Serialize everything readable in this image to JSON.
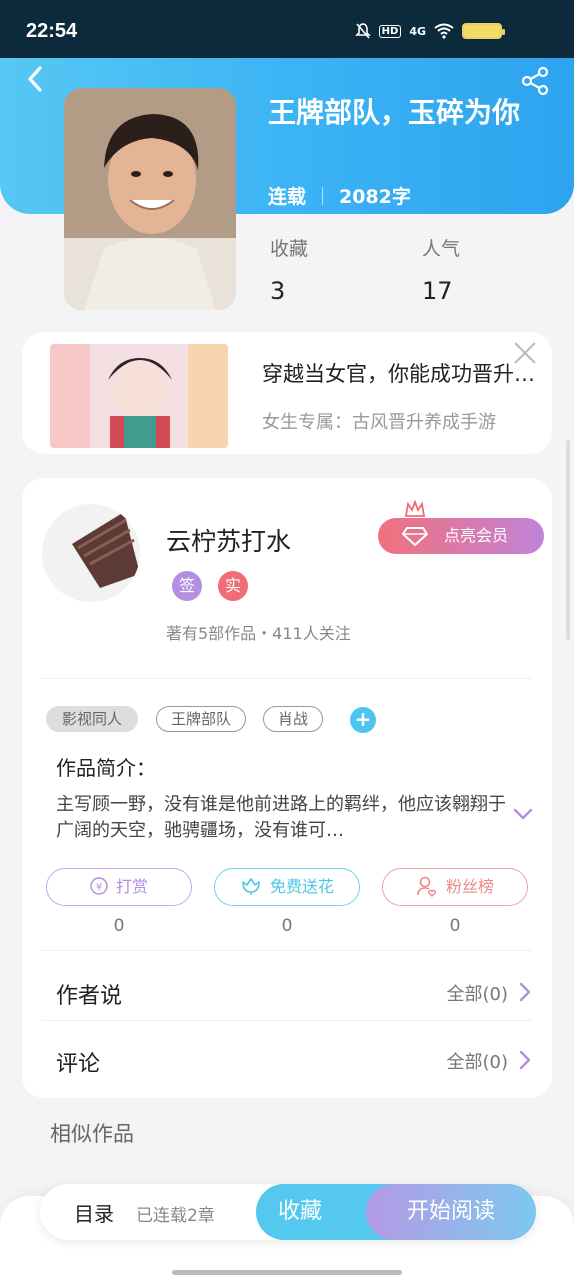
{
  "status_bar": {
    "time": "22:54",
    "network": "4G",
    "hd": "HD"
  },
  "book": {
    "title": "王牌部队，玉碎为你",
    "status": "连载",
    "word_count": "2082字",
    "stats": [
      {
        "label": "收藏",
        "value": "3"
      },
      {
        "label": "人气",
        "value": "17"
      }
    ]
  },
  "ad": {
    "title": "穿越当女官，你能成功晋升吗？",
    "subtitle": "女生专属：古风晋升养成手游"
  },
  "author": {
    "name": "云柠苏打水",
    "badges": [
      "签",
      "实"
    ],
    "stats": "著有5部作品・411人关注",
    "vip_label": "点亮会员"
  },
  "tags": [
    "影视同人",
    "王牌部队",
    "肖战"
  ],
  "intro": {
    "title": "作品简介：",
    "text": "主写顾一野，没有谁是他前进路上的羁绊，他应该翱翔于广阔的天空，驰骋疆场，没有谁可…"
  },
  "actions": [
    {
      "label": "打赏",
      "count": "0"
    },
    {
      "label": "免费送花",
      "count": "0"
    },
    {
      "label": "粉丝榜",
      "count": "0"
    }
  ],
  "rows": [
    {
      "title": "作者说",
      "right": "全部(0)"
    },
    {
      "title": "评论",
      "right": "全部(0)"
    }
  ],
  "similar_title": "相似作品",
  "bottom_bar": {
    "toc": "目录",
    "toc_sub": "已连载2章",
    "collect": "收藏",
    "read": "开始阅读"
  },
  "colors": {
    "header": "#3cb4f4",
    "accent_blue": "#4cc5f0",
    "tip_purple": "#b48ee0",
    "flower_cyan": "#4ec7e6",
    "fans_red": "#ec8a8a"
  }
}
